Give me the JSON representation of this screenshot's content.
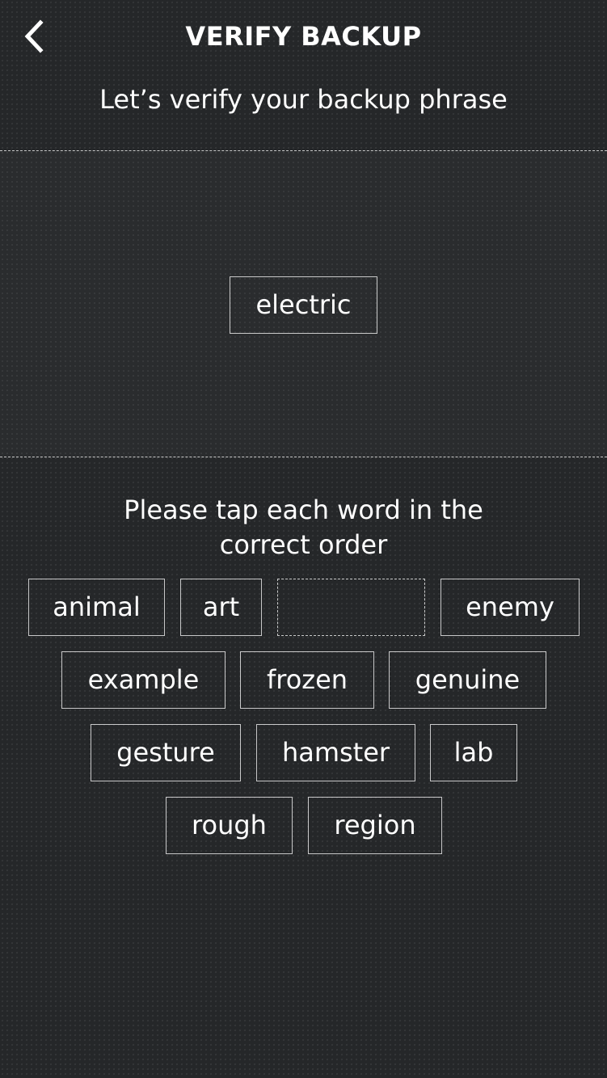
{
  "header": {
    "back_icon": "chevron-left-icon",
    "title": "VERIFY BACKUP",
    "subtitle": "Let’s verify your backup phrase"
  },
  "selected_words": [
    "electric"
  ],
  "instruction": {
    "line1": "Please tap each word in the",
    "line2": "correct order"
  },
  "word_bank": [
    {
      "word": "animal"
    },
    {
      "word": "art"
    },
    {
      "word": "",
      "placeholder": true
    },
    {
      "word": "enemy"
    },
    {
      "word": "example"
    },
    {
      "word": "frozen"
    },
    {
      "word": "genuine"
    },
    {
      "word": "gesture"
    },
    {
      "word": "hamster"
    },
    {
      "word": "lab"
    },
    {
      "word": "rough"
    },
    {
      "word": "region"
    }
  ]
}
